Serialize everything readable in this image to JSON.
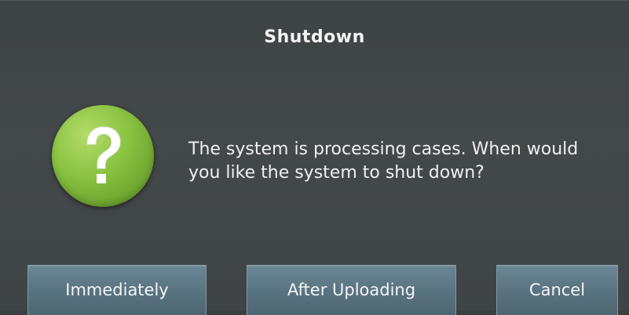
{
  "dialog": {
    "title": "Shutdown",
    "icon": "question-icon",
    "message": "The system is processing cases. When would you like the system to shut down?",
    "accent_color": "#8cc444",
    "button_color": "#58727f"
  },
  "buttons": {
    "immediately": "Immediately",
    "after_uploading": "After Uploading",
    "cancel": "Cancel"
  }
}
